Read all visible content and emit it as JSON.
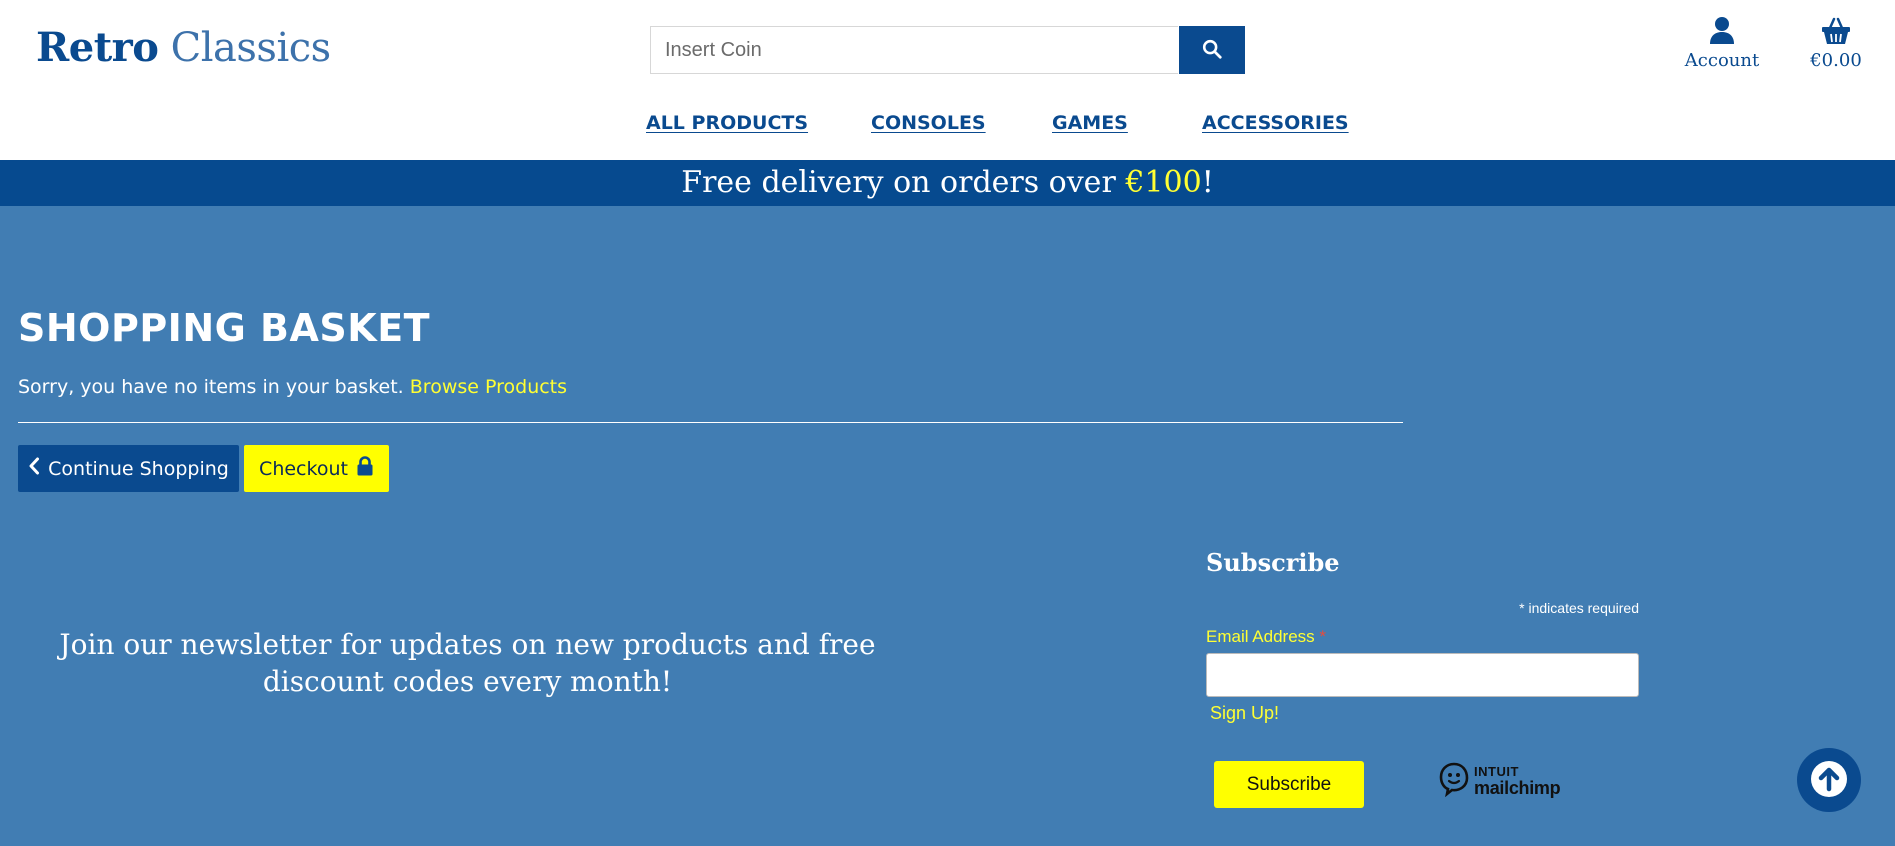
{
  "header": {
    "logo_bold": "Retro",
    "logo_light": "Classics",
    "search_placeholder": "Insert Coin",
    "search_icon": "search-icon",
    "account_label": "Account",
    "account_icon": "user-icon",
    "basket_total": "€0.00",
    "basket_icon": "basket-icon"
  },
  "nav": {
    "items": [
      "ALL PRODUCTS",
      "CONSOLES",
      "GAMES",
      "ACCESSORIES"
    ]
  },
  "banner": {
    "text_before": "Free delivery on orders over ",
    "amount": "€100",
    "text_after": "!"
  },
  "basket": {
    "title": "SHOPPING BASKET",
    "empty_message": "Sorry, you have no items in your basket.",
    "browse_link": "Browse Products",
    "continue_label": "Continue Shopping",
    "continue_icon": "chevron-left-icon",
    "checkout_label": "Checkout",
    "checkout_icon": "lock-icon"
  },
  "newsletter": {
    "text": "Join our newsletter for updates on new products and free discount codes every month!",
    "subscribe_title": "Subscribe",
    "required_star": "*",
    "required_note": " indicates required",
    "email_label": "Email Address",
    "email_required": "*",
    "signup_text": "Sign Up!",
    "subscribe_button": "Subscribe",
    "provider_line1": "INTUIT",
    "provider_line2": "mailchimp"
  },
  "back_to_top_icon": "arrow-up-circle-icon",
  "colors": {
    "brand_blue": "#0a4a8f",
    "page_blue": "#417db3",
    "accent_yellow": "#ffff00"
  }
}
